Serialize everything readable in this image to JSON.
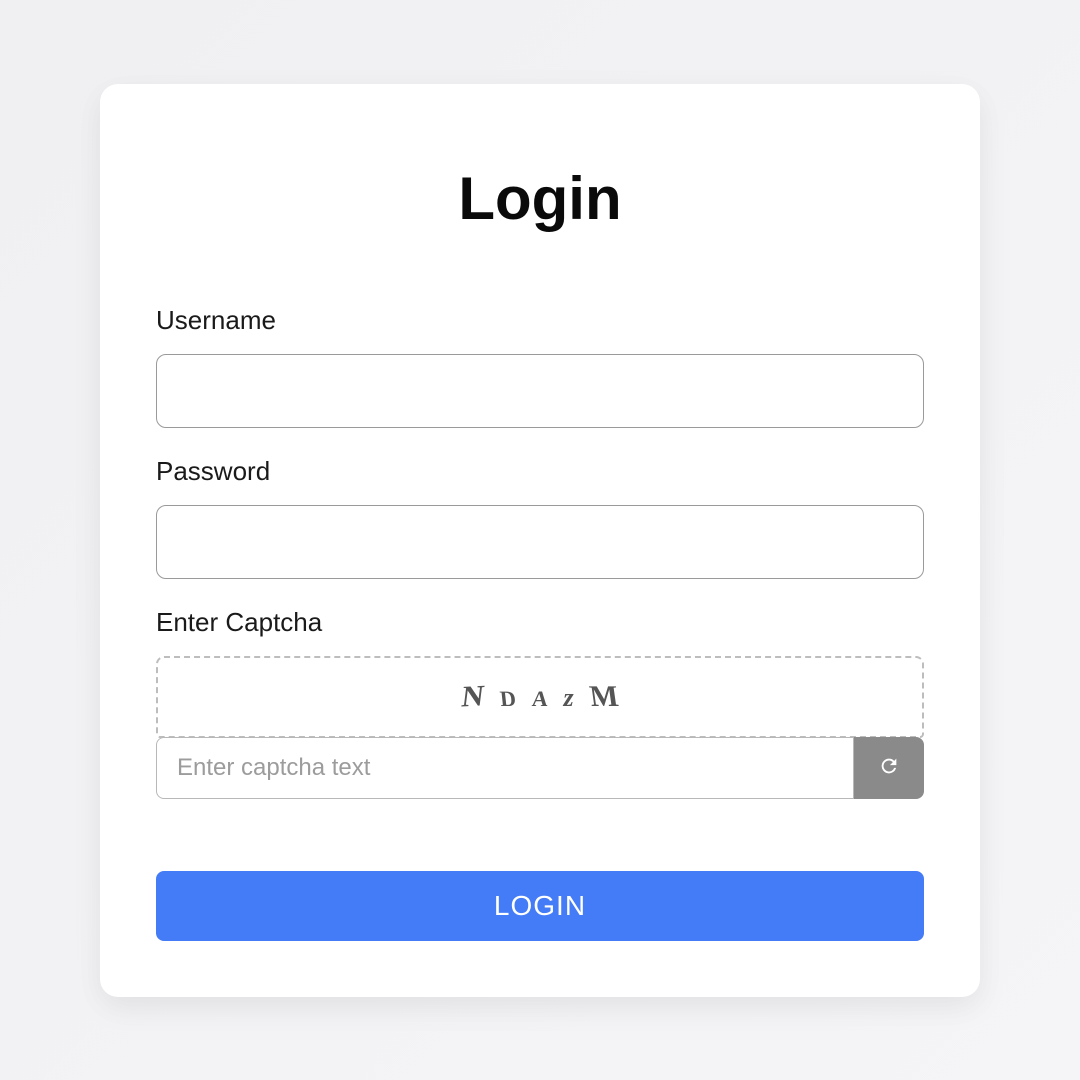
{
  "title": "Login",
  "form": {
    "username": {
      "label": "Username",
      "value": ""
    },
    "password": {
      "label": "Password",
      "value": ""
    },
    "captcha": {
      "label": "Enter Captcha",
      "chars": [
        "N",
        "D",
        "A",
        "z",
        "M"
      ],
      "placeholder": "Enter captcha text",
      "value": ""
    },
    "submit_label": "LOGIN"
  }
}
